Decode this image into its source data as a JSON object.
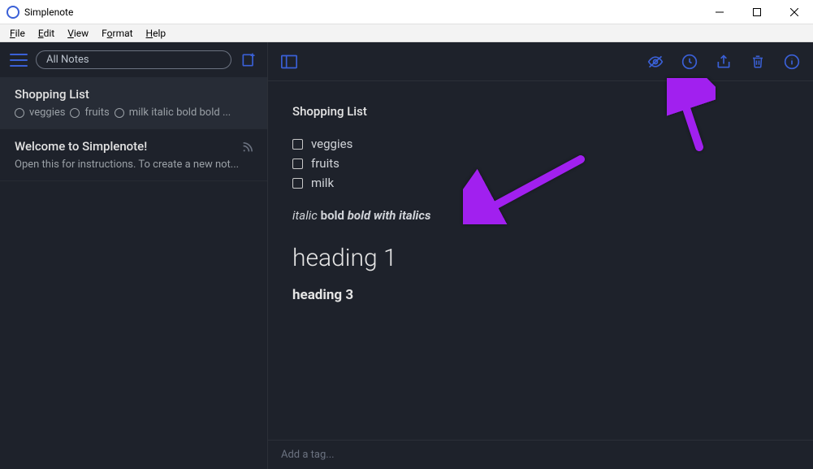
{
  "window": {
    "title": "Simplenote"
  },
  "menus": {
    "file": "File",
    "edit": "Edit",
    "view": "View",
    "format": "Format",
    "help": "Help"
  },
  "sidebar": {
    "search_label": "All Notes",
    "notes": [
      {
        "title": "Shopping List",
        "preview_items": [
          "veggies",
          "fruits",
          "milk italic bold bold ..."
        ],
        "selected": true
      },
      {
        "title": "Welcome to Simplenote!",
        "preview": "Open this for instructions. To create a new not...",
        "selected": false,
        "rss": true
      }
    ]
  },
  "editor": {
    "title": "Shopping List",
    "checklist": [
      "veggies",
      "fruits",
      "milk"
    ],
    "richline": {
      "italic": "italic",
      "bold": "bold",
      "bolditalic": "bold with italics"
    },
    "heading1": "heading 1",
    "heading3": "heading 3",
    "tag_placeholder": "Add a tag..."
  },
  "colors": {
    "accent": "#3a60d7",
    "bg": "#1e222b",
    "annotation": "#a120ef"
  }
}
